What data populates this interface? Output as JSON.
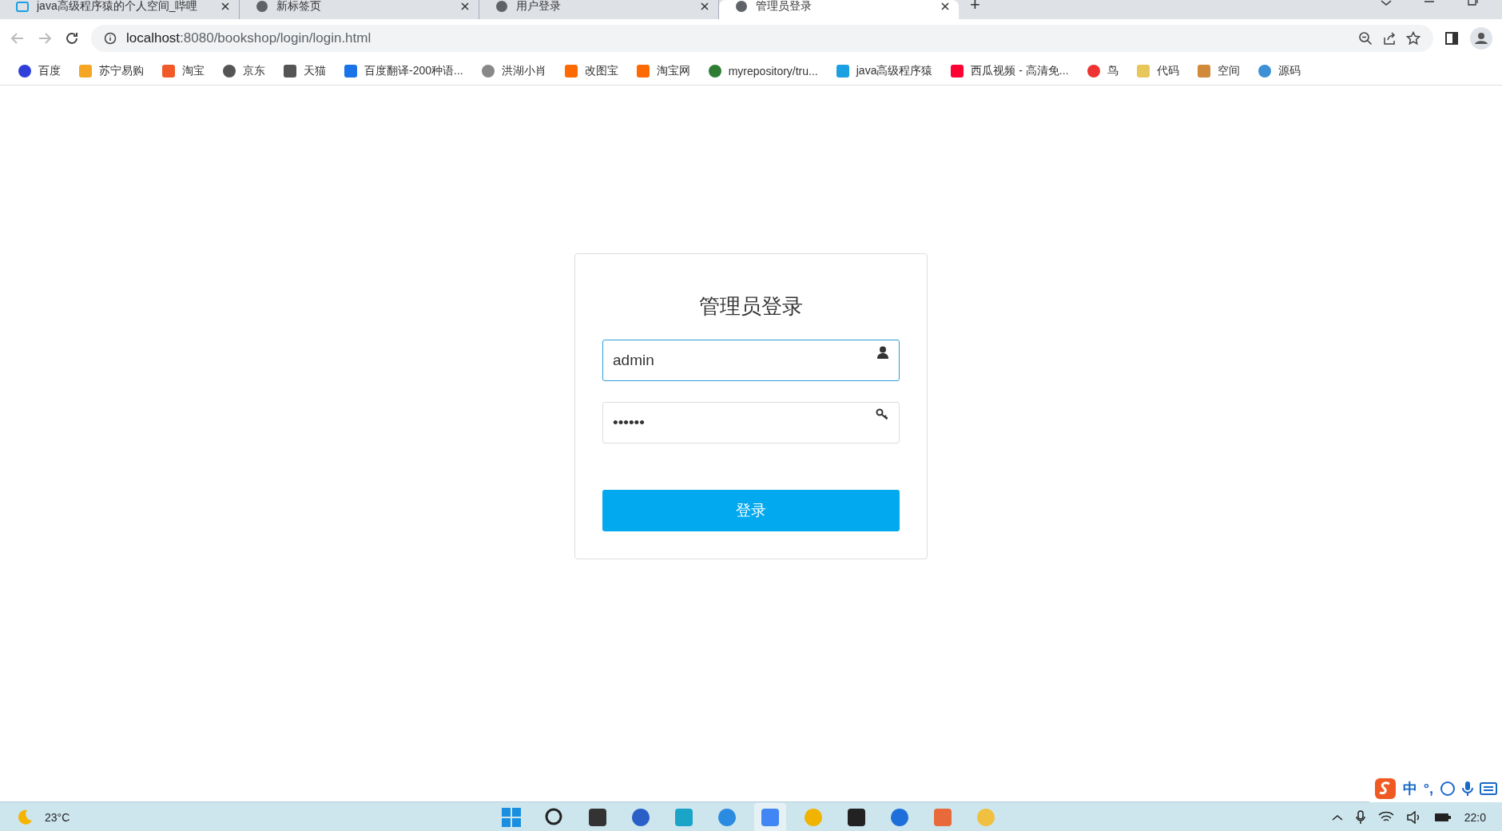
{
  "browser": {
    "tabs": [
      {
        "title": "java高级程序猿的个人空间_哔哩",
        "selected": false
      },
      {
        "title": "新标签页",
        "selected": false
      },
      {
        "title": "用户登录",
        "selected": false
      },
      {
        "title": "管理员登录",
        "selected": true
      }
    ],
    "new_tab": "+",
    "address": {
      "host": "localhost",
      "rest": ":8080/bookshop/login/login.html"
    },
    "bookmarks": [
      "百度",
      "苏宁易购",
      "淘宝",
      "京东",
      "天猫",
      "百度翻译-200种语...",
      "洪湖小肖",
      "改图宝",
      "淘宝网",
      "myrepository/tru...",
      "java高级程序猿",
      "西瓜视频 - 高清免...",
      "鸟",
      "代码",
      "空间",
      "源码"
    ]
  },
  "login": {
    "title": "管理员登录",
    "username": {
      "value": "admin",
      "focused": true
    },
    "password": {
      "value": "••••••",
      "focused": false
    },
    "submit": "登录"
  },
  "taskbar": {
    "weather": "23°C",
    "apps": [
      {
        "selected": false
      },
      {
        "selected": false
      },
      {
        "selected": false
      },
      {
        "selected": false
      },
      {
        "selected": false
      },
      {
        "selected": false
      },
      {
        "selected": true
      },
      {
        "selected": false
      },
      {
        "selected": false
      },
      {
        "selected": false
      },
      {
        "selected": false
      },
      {
        "selected": false
      }
    ],
    "clock": "22:0"
  },
  "ime": {
    "label": "中",
    "punct": "°,"
  }
}
